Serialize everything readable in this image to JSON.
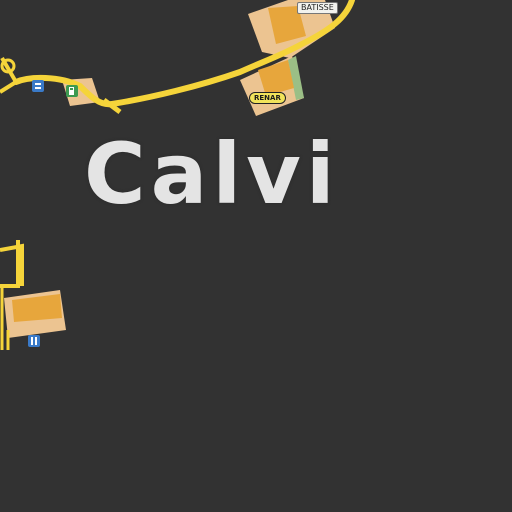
{
  "map": {
    "city_name": "Calvi",
    "pois": [
      {
        "name": "batisse",
        "label": "BATISSE"
      },
      {
        "name": "renar",
        "label": "RENAR"
      }
    ],
    "icons": [
      "shop-icon",
      "fuel-station-icon",
      "info-icon"
    ],
    "colors": {
      "background": "#323232",
      "road": "#f5d43a",
      "building_fill": "#e7a63c",
      "landuse": "#ecc491",
      "label": "#e4e4e4"
    }
  }
}
